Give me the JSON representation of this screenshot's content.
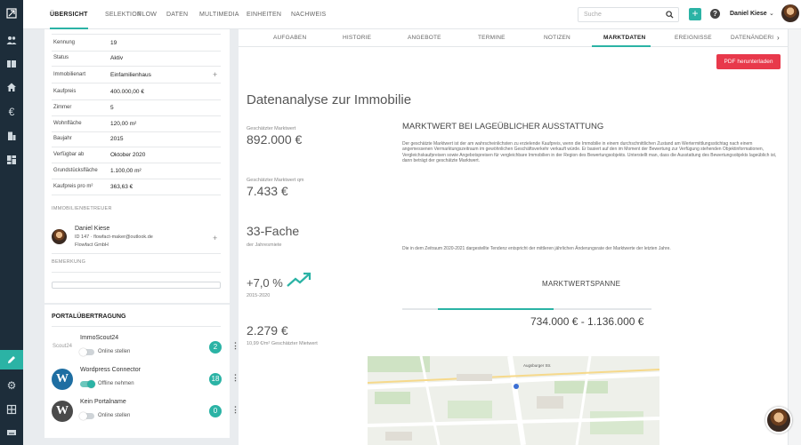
{
  "nav": {
    "tabs": [
      "ÜBERSICHT",
      "SELEKTION",
      "FLOW",
      "DATEN",
      "MULTIMEDIA",
      "EINHEITEN",
      "NACHWEIS"
    ],
    "search_placeholder": "Suche",
    "add_label": "+",
    "help_label": "?",
    "user_name": "Daniel Kiese"
  },
  "sidebar": {
    "icons": [
      "logo-icon",
      "users-icon",
      "grid-icon",
      "home-icon",
      "euro-icon",
      "building-icon",
      "dashboard-icon",
      "pencil-icon",
      "gear-icon",
      "apps-icon",
      "keyboard-icon"
    ]
  },
  "property": {
    "rows": [
      {
        "label": "Kennung",
        "value": "19"
      },
      {
        "label": "Status",
        "value": "Aktiv"
      },
      {
        "label": "Immobilienart",
        "value": "Einfamilienhaus"
      },
      {
        "label": "Kaufpreis",
        "value": "400.000,00 €"
      },
      {
        "label": "Zimmer",
        "value": "5"
      },
      {
        "label": "Wohnfläche",
        "value": "120,00 m²"
      },
      {
        "label": "Baujahr",
        "value": "2015"
      },
      {
        "label": "Verfügbar ab",
        "value": "Oktober 2020"
      },
      {
        "label": "Grundstücksfläche",
        "value": "1.100,00 m²"
      },
      {
        "label": "Kaufpreis pro m²",
        "value": "363,63 €"
      }
    ],
    "betreuer_label": "IMMOBILIENBETREUER",
    "betreuer": {
      "name": "Daniel Kiese",
      "line2": "ID 147 · flowfact-maker@outlook.de",
      "line3": "Flowfact GmbH"
    },
    "bemerkung_label": "BEMERKUNG"
  },
  "portal": {
    "title": "PORTALÜBERTRAGUNG",
    "items": [
      {
        "name": "ImmoScout24",
        "logo": "Scout24",
        "toggle_label": "Online stellen",
        "on": false,
        "count": "2"
      },
      {
        "name": "Wordpress Connector",
        "logo": "W",
        "toggle_label": "Offline nehmen",
        "on": true,
        "count": "18"
      },
      {
        "name": "Kein Portalname",
        "logo": "W",
        "toggle_label": "Online stellen",
        "on": false,
        "count": "0"
      }
    ]
  },
  "tabs": [
    "AUFGABEN",
    "HISTORIE",
    "ANGEBOTE",
    "TERMINE",
    "NOTIZEN",
    "MARKTDATEN",
    "EREIGNISSE",
    "DATENÄNDERI"
  ],
  "active_tab": "MARKTDATEN",
  "pdf_button": "PDF herunterladen",
  "analysis": {
    "title": "Datenanalyse zur Immobilie",
    "kpi": [
      {
        "label": "Geschätzter Marktwert",
        "value": "892.000 €"
      },
      {
        "label": "Geschätzter Marktwert qm",
        "value": "7.433 €"
      },
      {
        "value": "33-Fache",
        "label": "der Jahresmiete"
      },
      {
        "value": "+7,0 %",
        "label": "2015-2020"
      },
      {
        "value": "2.279 €",
        "label": "10,99 €/m² Geschätzter Mietwert"
      }
    ],
    "market_heading": "MARKTWERT BEI LAGEÜBLICHER AUSSTATTUNG",
    "market_text": "Der geschätzte Marktwert ist der am wahrscheinlichsten zu erzielende Kaufpreis, wenn die Immobilie in einem durchschnittlichen Zustand am Wertermittlungsstichtag nach einem angemessenen Vermarktungszeitraum im gewöhnlichen Geschäftsverkehr verkauft würde. Er basiert auf den im Moment der Bewertung zur Verfügung stehenden Objektinformationen, Vergleichskaufpreisen sowie Angebotspreisen für vergleichbare Immobilien in der Region des Bewertungsobjekts. Unterstellt man, dass die Ausstattung des Bewertungsobjekts lageüblich ist, dann beträgt der geschätzte Marktwert.",
    "tendency_text": "Die in dem Zeitraum 2020-2021 dargestellte Tendenz entspricht der mittleren jährlichen Änderungsrate der Marktwerte der letzten Jahre.",
    "span_heading": "MARKTWERTSPANNE",
    "span_value": "734.000 € - 1.136.000 €",
    "map_label": "Augsburger Str."
  }
}
